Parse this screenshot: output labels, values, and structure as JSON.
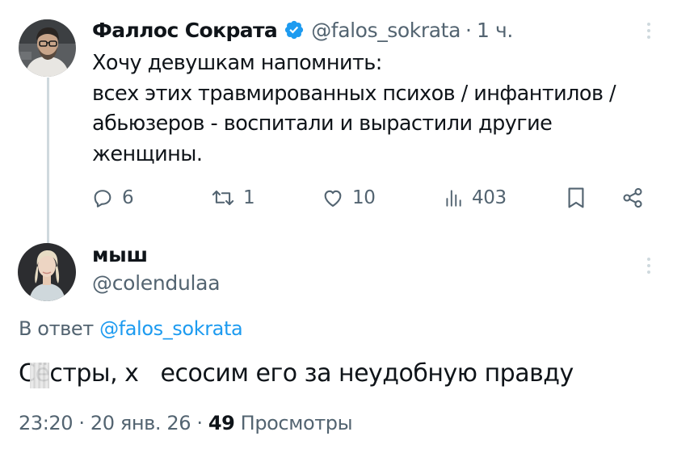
{
  "tweet": {
    "author": {
      "display_name": "Фаллос Сократа",
      "handle": "@falos_sokrata",
      "verified": true,
      "avatar_icon": "avatar-man-glasses"
    },
    "time_ago": "1 ч.",
    "separator": "·",
    "text_lines": [
      "Хочу девушкам напомнить:",
      "всех этих травмированных психов / инфантилов /",
      "абьюзеров  - воспитали и вырастили другие",
      "женщины."
    ],
    "actions": {
      "replies": "6",
      "retweets": "1",
      "likes": "10",
      "views": "403"
    }
  },
  "reply": {
    "author": {
      "display_name": "мыш",
      "handle": "@colendulaa",
      "avatar_icon": "avatar-woman"
    },
    "in_reply_prefix": "В ответ",
    "in_reply_mention": "@falos_sokrata",
    "text": "Сёстры, х   есосим его за неудобную правду",
    "time": "23:20",
    "date": "20 янв. 26",
    "separator": "·",
    "views_count": "49",
    "views_label": "Просмотры"
  },
  "colors": {
    "text_primary": "#0f1419",
    "text_secondary": "#536471",
    "accent": "#1d9bf0",
    "thread_line": "#cfd9de"
  }
}
